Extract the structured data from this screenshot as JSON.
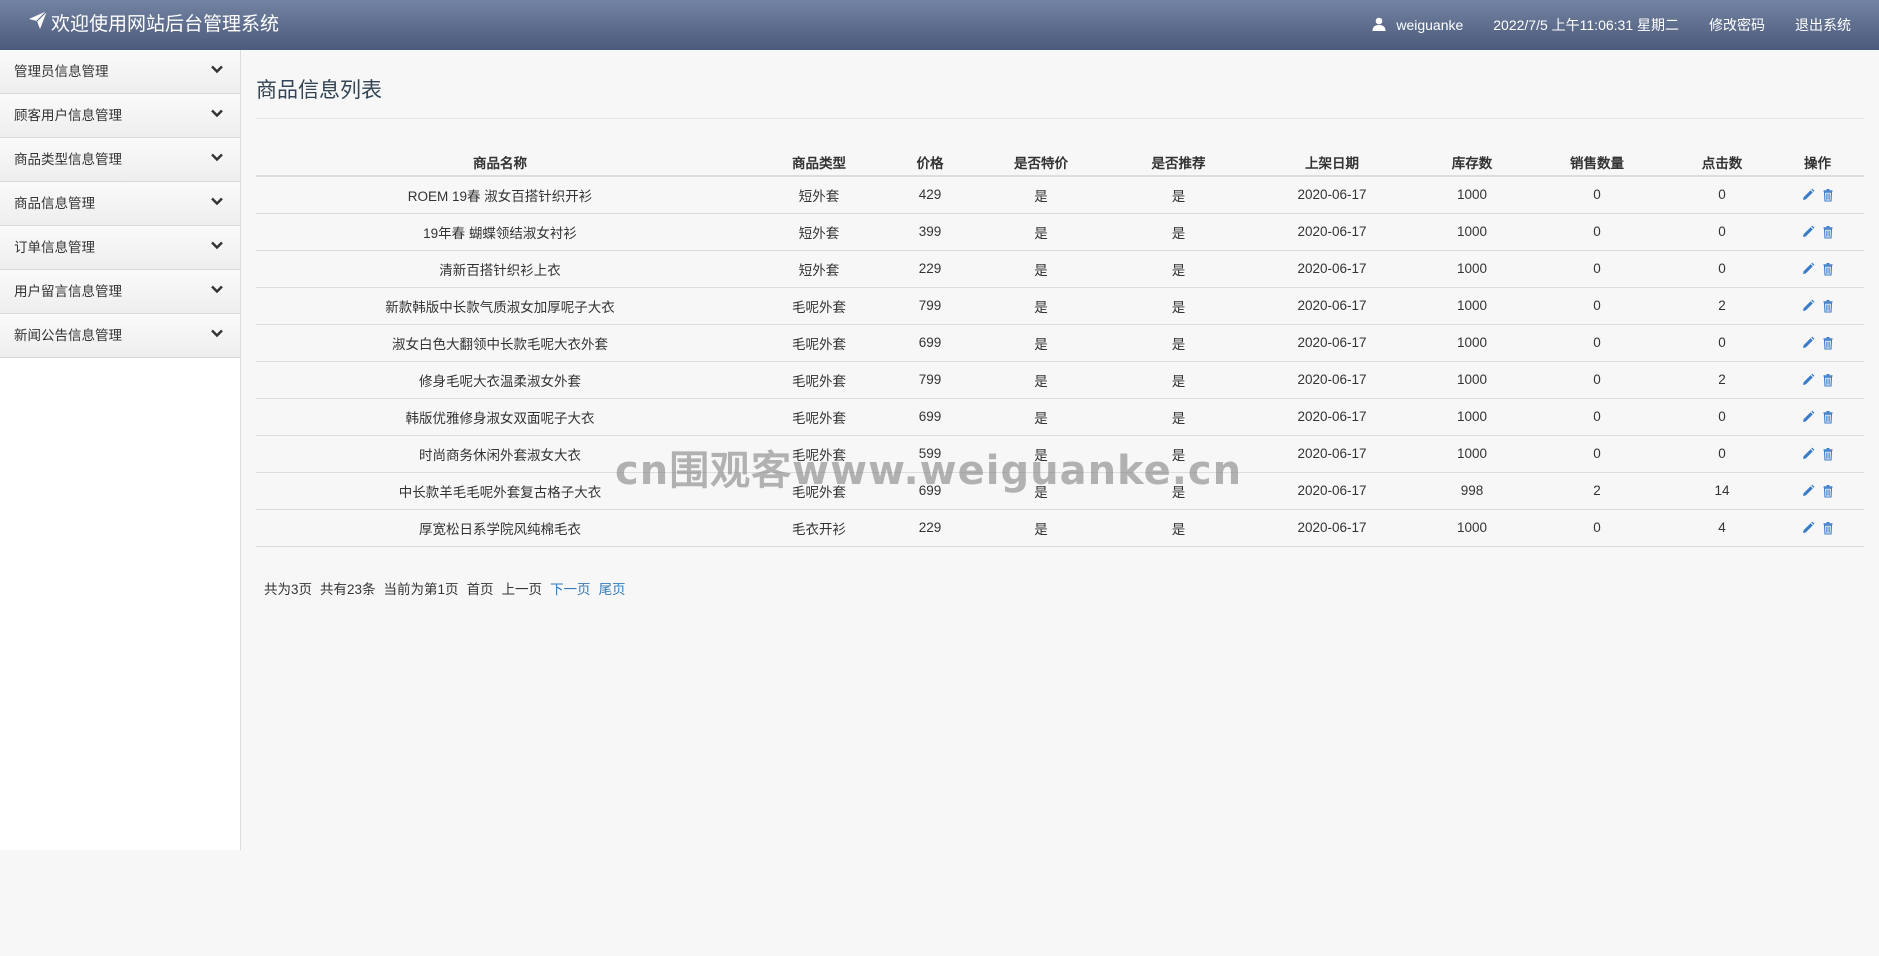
{
  "header": {
    "title": "欢迎使用网站后台管理系统",
    "username": "weiguanke",
    "datetime": "2022/7/5 上午11:06:31 星期二",
    "change_password": "修改密码",
    "logout": "退出系统"
  },
  "sidebar": {
    "items": [
      {
        "label": "管理员信息管理"
      },
      {
        "label": "顾客用户信息管理"
      },
      {
        "label": "商品类型信息管理"
      },
      {
        "label": "商品信息管理"
      },
      {
        "label": "订单信息管理"
      },
      {
        "label": "用户留言信息管理"
      },
      {
        "label": "新闻公告信息管理"
      }
    ]
  },
  "main": {
    "title": "商品信息列表",
    "columns": [
      "商品名称",
      "商品类型",
      "价格",
      "是否特价",
      "是否推荐",
      "上架日期",
      "库存数",
      "销售数量",
      "点击数",
      "操作"
    ],
    "rows": [
      [
        "ROEM 19春 淑女百搭针织开衫",
        "短外套",
        "429",
        "是",
        "是",
        "2020-06-17",
        "1000",
        "0",
        "0"
      ],
      [
        "19年春 蝴蝶领结淑女衬衫",
        "短外套",
        "399",
        "是",
        "是",
        "2020-06-17",
        "1000",
        "0",
        "0"
      ],
      [
        "清新百搭针织衫上衣",
        "短外套",
        "229",
        "是",
        "是",
        "2020-06-17",
        "1000",
        "0",
        "0"
      ],
      [
        "新款韩版中长款气质淑女加厚呢子大衣",
        "毛呢外套",
        "799",
        "是",
        "是",
        "2020-06-17",
        "1000",
        "0",
        "2"
      ],
      [
        "淑女白色大翻领中长款毛呢大衣外套",
        "毛呢外套",
        "699",
        "是",
        "是",
        "2020-06-17",
        "1000",
        "0",
        "0"
      ],
      [
        "修身毛呢大衣温柔淑女外套",
        "毛呢外套",
        "799",
        "是",
        "是",
        "2020-06-17",
        "1000",
        "0",
        "2"
      ],
      [
        "韩版优雅修身淑女双面呢子大衣",
        "毛呢外套",
        "699",
        "是",
        "是",
        "2020-06-17",
        "1000",
        "0",
        "0"
      ],
      [
        "时尚商务休闲外套淑女大衣",
        "毛呢外套",
        "599",
        "是",
        "是",
        "2020-06-17",
        "1000",
        "0",
        "0"
      ],
      [
        "中长款羊毛毛呢外套复古格子大衣",
        "毛呢外套",
        "699",
        "是",
        "是",
        "2020-06-17",
        "998",
        "2",
        "14"
      ],
      [
        "厚宽松日系学院风纯棉毛衣",
        "毛衣开衫",
        "229",
        "是",
        "是",
        "2020-06-17",
        "1000",
        "0",
        "4"
      ]
    ]
  },
  "pager": {
    "total_pages": "共为3页",
    "total_items": "共有23条",
    "current": "当前为第1页",
    "first": "首页",
    "prev": "上一页",
    "next": "下一页",
    "last": "尾页"
  },
  "watermark": "cn围观客www.weiguanke.cn",
  "icons": {
    "edit": "pencil-icon",
    "delete": "trash-icon",
    "user": "user-icon",
    "brand": "send-icon",
    "menu_toggle": "chevron-down-icon"
  },
  "colors": {
    "topbar_top": "#7383a2",
    "topbar_bottom": "#4c5a7a",
    "link": "#337ab7",
    "icon_blue": "#3a7bc8"
  }
}
